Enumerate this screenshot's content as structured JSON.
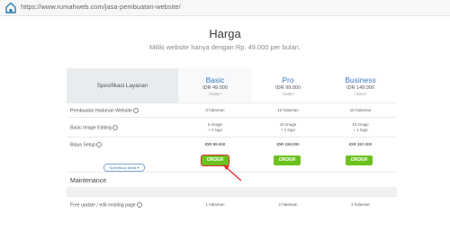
{
  "browser": {
    "url": "https://www.rumahweb.com/jasa-pembuatan-website/"
  },
  "page": {
    "title": "Harga",
    "subtitle": "Miliki website hanya dengan Rp. 49.000 per bulan."
  },
  "table": {
    "header_label": "Spesifikasi Layanan",
    "plans": [
      {
        "name": "Basic",
        "price": "IDR 49.000",
        "period": "/ bulan*"
      },
      {
        "name": "Pro",
        "price": "IDR 99.000",
        "period": "/ bulan*"
      },
      {
        "name": "Business",
        "price": "IDR 149.000",
        "period": "/ bulan*"
      }
    ],
    "rows": [
      {
        "label": "Pembuatan Halaman Website",
        "values": [
          "5 halaman",
          "10 halaman",
          "15 halaman"
        ]
      },
      {
        "label": "Basic Image Editing",
        "values": [
          "5 image\n+ 1 logo",
          "10 image\n+ 1 logo",
          "15 image\n+ 1 logo"
        ]
      },
      {
        "label": "Biaya Setup",
        "values": [
          "IDR 99.000",
          "IDR 198.000",
          "IDR 297.000"
        ]
      }
    ],
    "order_label": "ORDER",
    "spec_toggle_label": "Spesifikasi detail",
    "maintenance": {
      "title": "Maintenance",
      "rows": [
        {
          "label": "Free update / edit existing page",
          "values": [
            "1 halaman",
            "2 halaman",
            "3 halaman"
          ]
        }
      ]
    }
  },
  "colors": {
    "accent": "#3b78c8",
    "order_button": "#6bc21f",
    "highlight": "#e22b2b"
  },
  "icons": {
    "home": "home-icon",
    "info": "info-icon",
    "chevron": "chevron-down-icon",
    "annotation": "arrow-annotation-icon"
  }
}
